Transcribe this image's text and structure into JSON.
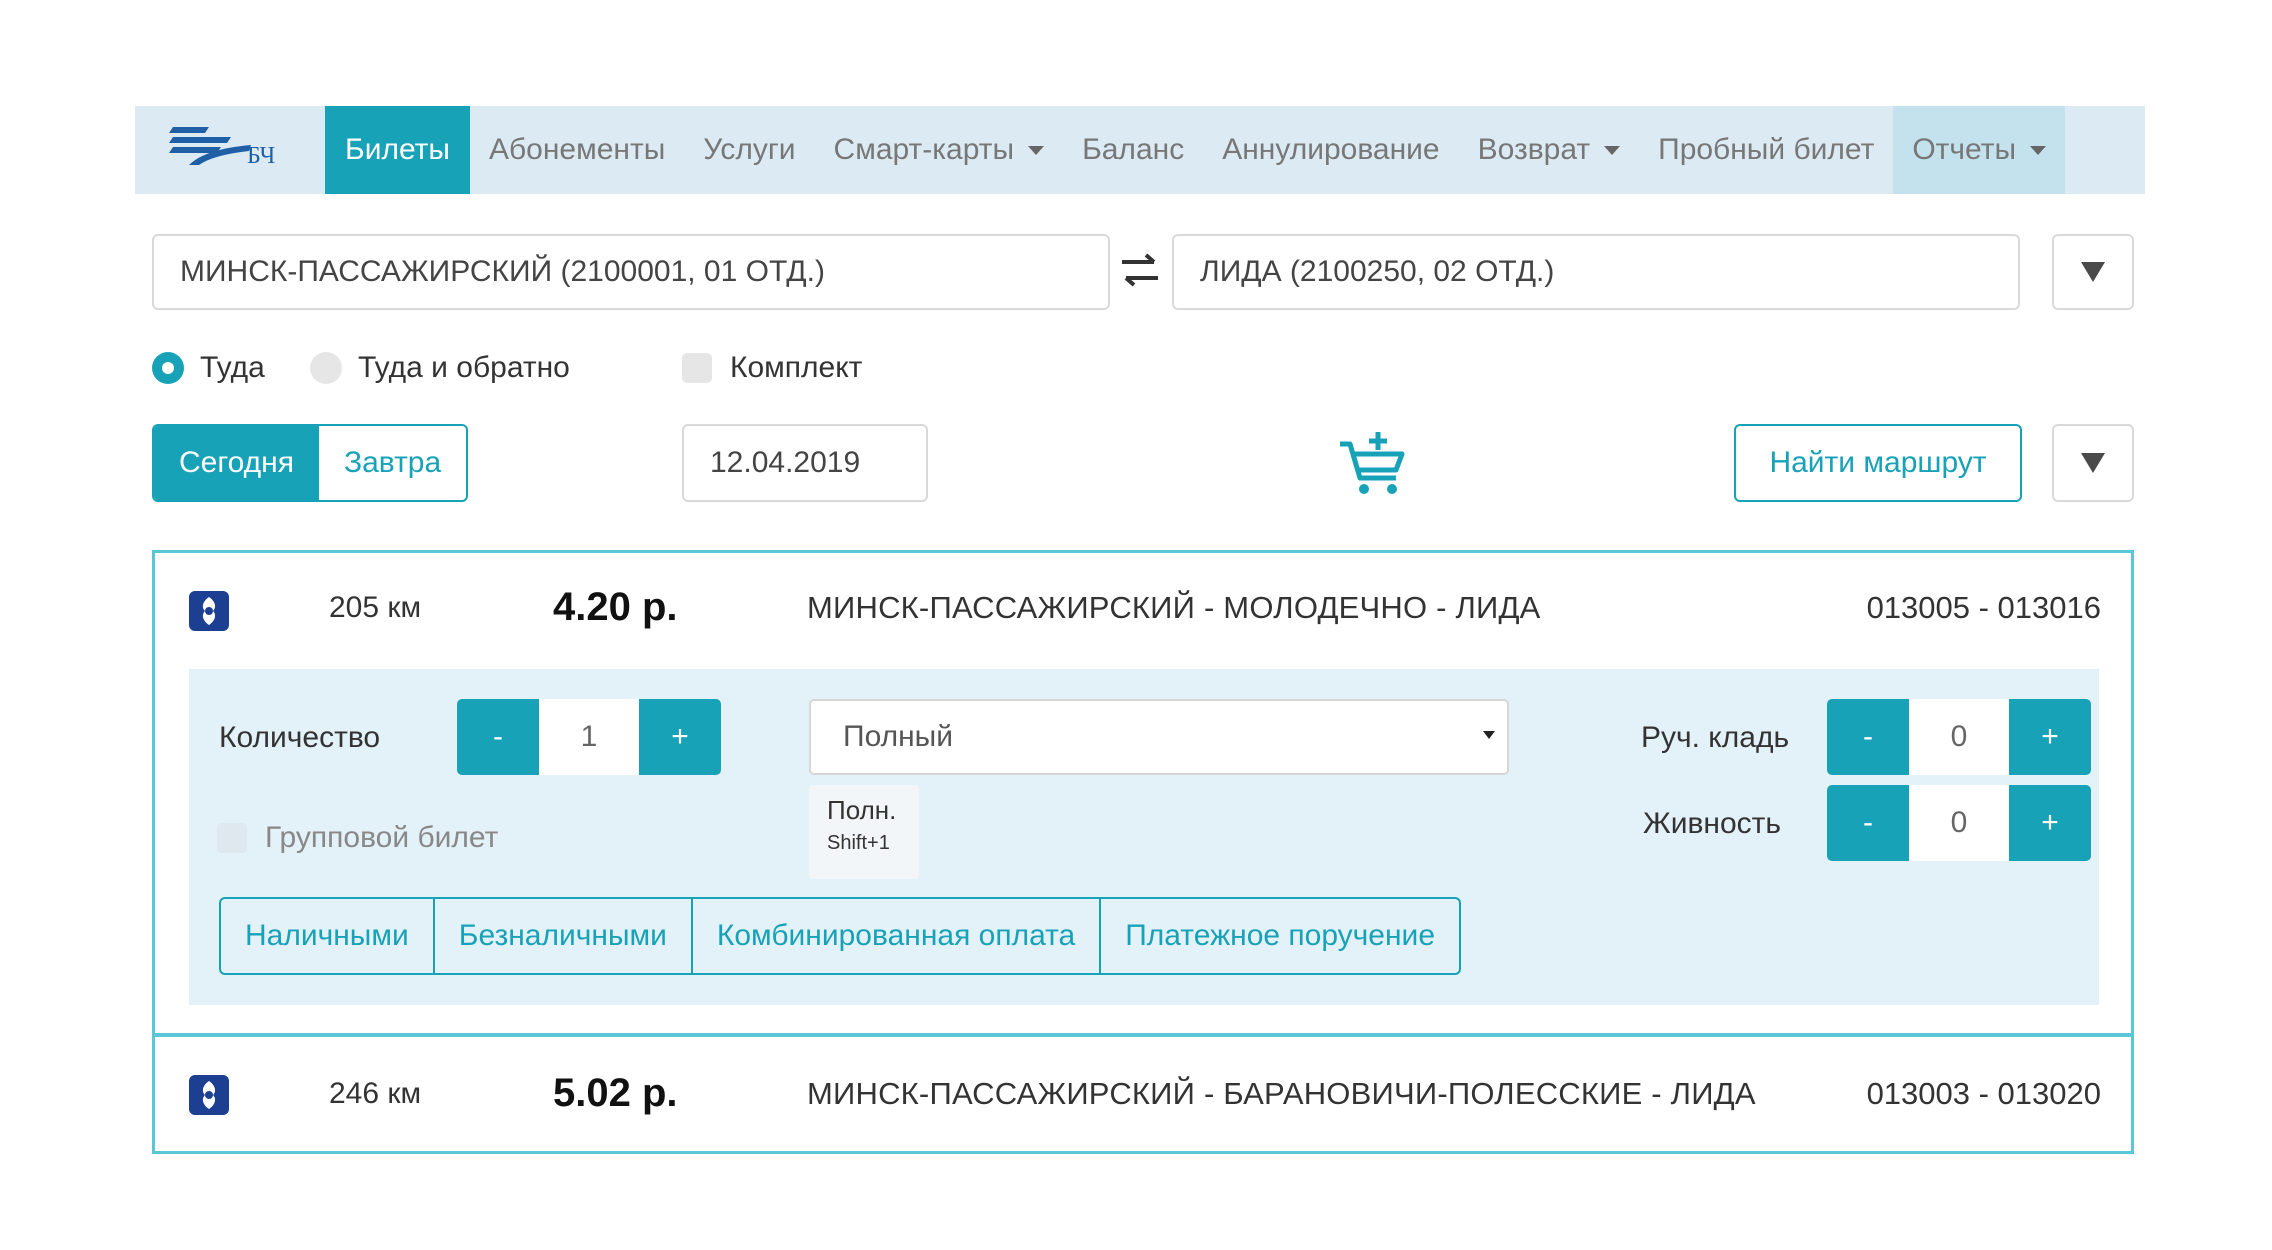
{
  "nav": {
    "brand": "БЧ",
    "items": [
      {
        "label": "Билеты"
      },
      {
        "label": "Абонементы"
      },
      {
        "label": "Услуги"
      },
      {
        "label": "Смарт-карты"
      },
      {
        "label": "Баланс"
      },
      {
        "label": "Аннулирование"
      },
      {
        "label": "Возврат"
      },
      {
        "label": "Пробный билет"
      },
      {
        "label": "Отчеты"
      }
    ],
    "active": "Билеты",
    "accent": "#17a2b8"
  },
  "search": {
    "from": "МИНСК-ПАССАЖИРСКИЙ (2100001, 01 ОТД.)",
    "to": "ЛИДА (2100250, 02 ОТД.)",
    "trip_one_way": "Туда",
    "trip_round": "Туда и обратно",
    "kit": "Комплект",
    "today": "Сегодня",
    "tomorrow": "Завтра",
    "date": "12.04.2019",
    "find": "Найти маршрут"
  },
  "results": [
    {
      "km": "205 км",
      "price": "4.20 р.",
      "route": "МИНСК-ПАССАЖИРСКИЙ - МОЛОДЕЧНО - ЛИДА",
      "numbers": "013005 - 013016",
      "expanded": true
    },
    {
      "km": "246 км",
      "price": "5.02 р.",
      "route": "МИНСК-ПАССАЖИРСКИЙ - БАРАНОВИЧИ-ПОЛЕССКИЕ - ЛИДА",
      "numbers": "013003 - 013020",
      "expanded": false
    }
  ],
  "details": {
    "quantity_label": "Количество",
    "quantity": "1",
    "minus": "-",
    "plus": "+",
    "tariff": "Полный",
    "hint_label": "Полн.",
    "hint_shortcut": "Shift+1",
    "group_ticket": "Групповой билет",
    "hand_luggage_label": "Руч. кладь",
    "hand_luggage": "0",
    "animals_label": "Живность",
    "animals": "0",
    "payments": [
      "Наличными",
      "Безналичными",
      "Комбинированная оплата",
      "Платежное поручение"
    ]
  }
}
